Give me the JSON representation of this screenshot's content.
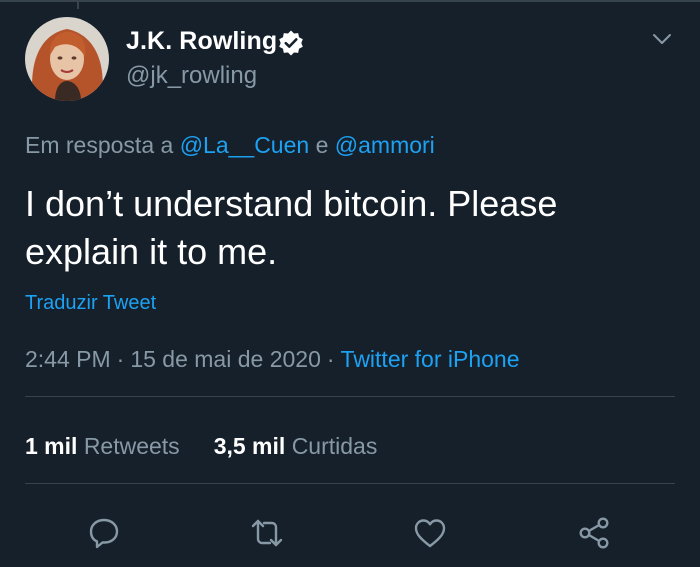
{
  "colors": {
    "background": "#15202b",
    "text_primary": "#ffffff",
    "text_secondary": "#8899a6",
    "accent": "#1da1f2",
    "divider": "#38444d"
  },
  "author": {
    "display_name": "J.K. Rowling",
    "handle": "@jk_rowling",
    "verified": true
  },
  "reply_context": {
    "prefix": "Em resposta a",
    "mention_1": "@La__Cuen",
    "joiner": "e",
    "mention_2": "@ammori"
  },
  "tweet": {
    "text": "I don’t understand bitcoin. Please explain it to me.",
    "translate_label": "Traduzir Tweet",
    "time": "2:44 PM",
    "date": "15 de mai de 2020",
    "source": "Twitter for iPhone",
    "separator": "·"
  },
  "stats": {
    "retweets_count": "1 mil",
    "retweets_label": "Retweets",
    "likes_count": "3,5 mil",
    "likes_label": "Curtidas"
  },
  "icons": {
    "verified": "verified-badge-icon",
    "menu": "chevron-down-icon",
    "reply": "reply-icon",
    "retweet": "retweet-icon",
    "like": "heart-icon",
    "share": "share-icon"
  }
}
